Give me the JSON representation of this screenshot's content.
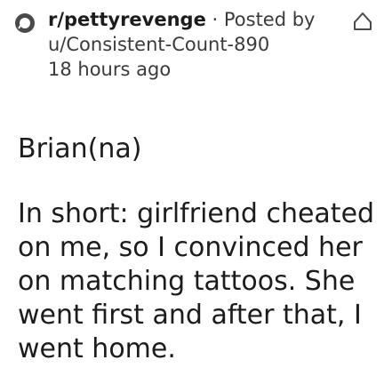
{
  "post": {
    "subreddit": "r/pettyrevenge",
    "posted_by_prefix": "· Posted by",
    "author": "u/Consistent-Count-890",
    "time": "18 hours ago",
    "username_title": "Brian(na)",
    "body": "In short: girlfriend cheated on me, so I convinced her on matching tattoos. She went first and after that, I went home."
  },
  "icons": {
    "subreddit_icon": "subreddit-icon",
    "notification_icon": "bell-icon"
  },
  "colors": {
    "text_primary": "#1c1c1c",
    "text_secondary": "#3a3a3a",
    "icon_stroke": "#4a4a4a",
    "background": "#ffffff"
  }
}
